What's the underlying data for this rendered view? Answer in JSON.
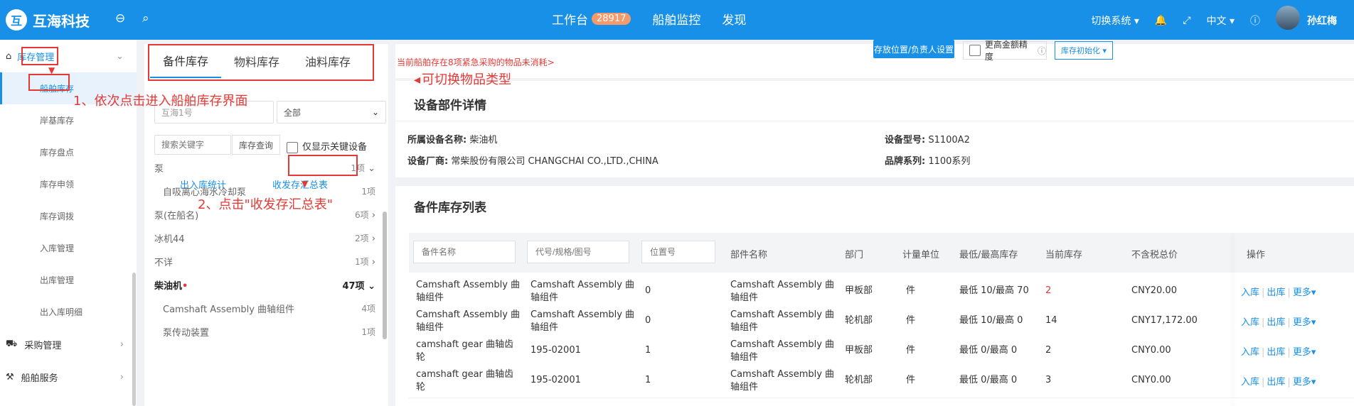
{
  "app": {
    "brand_mark": "互",
    "brand": "互海科技"
  },
  "topnav": {
    "workbench": "工作台",
    "workbench_badge": "28917",
    "ship_monitor": "船舶监控",
    "discover": "发现"
  },
  "topright": {
    "switch_system": "切换系统 ▾",
    "language": "中文 ▾",
    "user": "孙红梅"
  },
  "sidebar": {
    "group_inventory": "库存管理",
    "items": [
      "船舶库存",
      "岸基库存",
      "库存盘点",
      "库存申领",
      "库存调拨",
      "入库管理",
      "出库管理",
      "出入库明细"
    ],
    "group_purchase": "采购管理",
    "group_ship_service": "船舶服务"
  },
  "tabs": [
    "备件库存",
    "物料库存",
    "油料库存"
  ],
  "alert_text": "当前船舶存在8项紧急采购的物品未消耗>",
  "annotations": {
    "tabs_note": "可切换物品类型",
    "step1": "1、依次点击进入船舶库存界面",
    "step2": "2、点击\"收发存汇总表\""
  },
  "filters": {
    "ship": "互海1号",
    "scope": "全部",
    "keyword_placeholder": "搜索关键字",
    "query_button": "库存查询",
    "key_equipment_only": "仅显示关键设备",
    "io_stats": "出入库统计",
    "summary_report": "收发存汇总表"
  },
  "categories": [
    {
      "name": "泵",
      "count": "1项",
      "chevron": "⌄"
    },
    {
      "name": "自吸离心海水冷却泵",
      "count": "1项",
      "chevron": ""
    },
    {
      "name": "泵(在船名)",
      "count": "6项",
      "chevron": "›"
    },
    {
      "name": "冰机44",
      "count": "2项",
      "chevron": "›"
    },
    {
      "name": "不详",
      "count": "1项",
      "chevron": "›"
    },
    {
      "name": "柴油机",
      "count": "47项",
      "chevron": "⌄"
    },
    {
      "name": "Camshaft Assembly 曲轴组件",
      "count": "4项",
      "chevron": ""
    },
    {
      "name": "泵传动装置",
      "count": "1项",
      "chevron": ""
    }
  ],
  "toolbar": {
    "location_settings": "存放位置/负责人设置",
    "high_precision": "更高金额精度",
    "init": "库存初始化 ▾"
  },
  "equipment": {
    "title": "设备部件详情",
    "name_label": "所属设备名称:",
    "name_value": "柴油机",
    "model_label": "设备型号:",
    "model_value": "S1100A2",
    "maker_label": "设备厂商:",
    "maker_value": "常柴股份有限公司 CHANGCHAI CO.,LTD.,CHINA",
    "series_label": "品牌系列:",
    "series_value": "1100系列"
  },
  "list": {
    "title": "备件库存列表",
    "filter_placeholders": [
      "备件名称",
      "代号/规格/图号",
      "位置号"
    ],
    "headers": [
      "部件名称",
      "部门",
      "计量单位",
      "最低/最高库存",
      "当前库存",
      "不含税总价",
      "操作"
    ],
    "rows": [
      {
        "name1": "Camshaft Assembly 曲",
        "name2": "轴组件",
        "code1": "Camshaft Assembly 曲",
        "code2": "轴组件",
        "pos": "0",
        "part1": "Camshaft Assembly 曲",
        "part2": "轴组件",
        "dept": "甲板部",
        "unit": "件",
        "minmax": "最低 10/最高 70",
        "stock": "2",
        "price": "CNY20.00"
      },
      {
        "name1": "Camshaft Assembly 曲",
        "name2": "轴组件",
        "code1": "Camshaft Assembly 曲",
        "code2": "轴组件",
        "pos": "0",
        "part1": "Camshaft Assembly 曲",
        "part2": "轴组件",
        "dept": "轮机部",
        "unit": "件",
        "minmax": "最低 10/最高 0",
        "stock": "14",
        "price": "CNY17,172.00"
      },
      {
        "name1": "camshaft gear 曲轴齿",
        "name2": "轮",
        "code1": "195-02001",
        "code2": "",
        "pos": "1",
        "part1": "Camshaft Assembly 曲",
        "part2": "轴组件",
        "dept": "甲板部",
        "unit": "件",
        "minmax": "最低 0/最高 0",
        "stock": "2",
        "price": "CNY0.00"
      },
      {
        "name1": "camshaft gear 曲轴齿",
        "name2": "轮",
        "code1": "195-02001",
        "code2": "",
        "pos": "1",
        "part1": "Camshaft Assembly 曲",
        "part2": "轴组件",
        "dept": "轮机部",
        "unit": "件",
        "minmax": "最低 0/最高 0",
        "stock": "3",
        "price": "CNY0.00"
      }
    ],
    "ops": {
      "in": "入库",
      "out": "出库",
      "more": "更多▾"
    }
  },
  "colors": {
    "brand": "#1890e8",
    "annotation": "#e53935",
    "badge": "#f59a6b"
  }
}
